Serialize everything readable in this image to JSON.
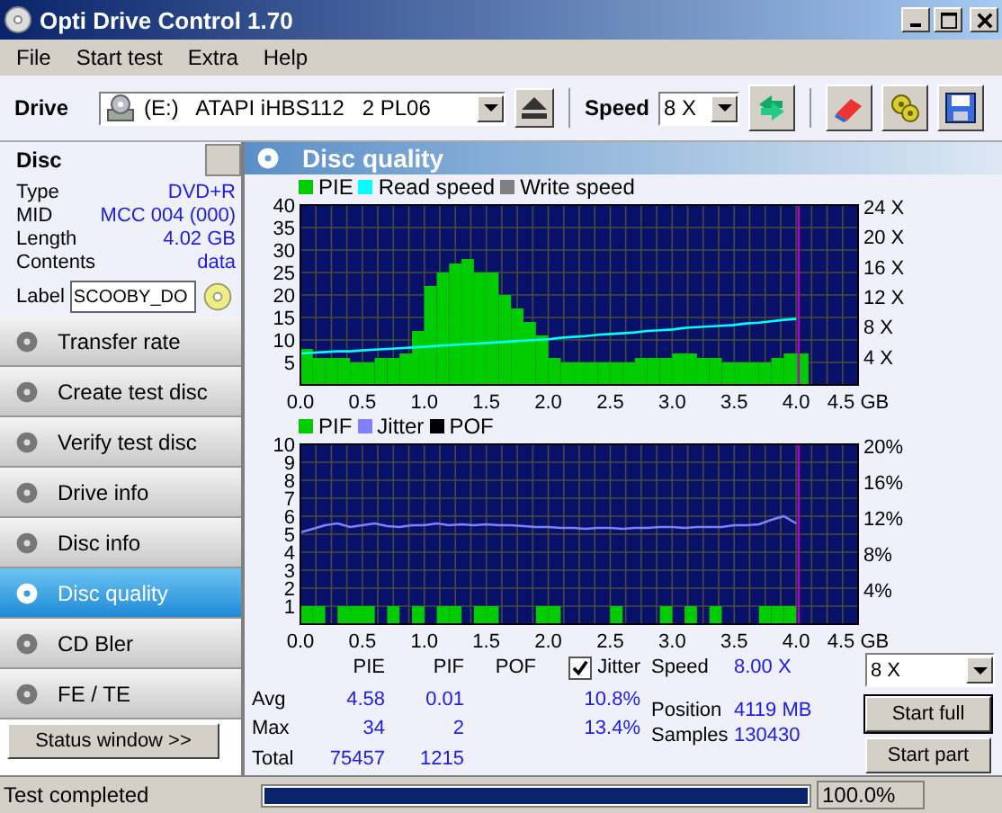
{
  "window": {
    "title": "Opti Drive Control 1.70"
  },
  "menu": [
    "File",
    "Start test",
    "Extra",
    "Help"
  ],
  "toolbar": {
    "drive_label": "Drive",
    "drive": "(E:)   ATAPI iHBS112   2 PL06",
    "speed_label": "Speed",
    "speed": "8 X"
  },
  "disc": {
    "title": "Disc",
    "fields": [
      {
        "label": "Type",
        "value": "DVD+R"
      },
      {
        "label": "MID",
        "value": "MCC 004 (000)"
      },
      {
        "label": "Length",
        "value": "4.02 GB"
      },
      {
        "label": "Contents",
        "value": "data"
      }
    ],
    "label_field": {
      "label": "Label",
      "value": "SCOOBY_DO"
    }
  },
  "nav": [
    {
      "label": "Transfer rate",
      "selected": false
    },
    {
      "label": "Create test disc",
      "selected": false
    },
    {
      "label": "Verify test disc",
      "selected": false
    },
    {
      "label": "Drive info",
      "selected": false
    },
    {
      "label": "Disc info",
      "selected": false
    },
    {
      "label": "Disc quality",
      "selected": true
    },
    {
      "label": "CD Bler",
      "selected": false
    },
    {
      "label": "FE / TE",
      "selected": false
    }
  ],
  "status_window_button": "Status window >>",
  "panel": {
    "title": "Disc quality",
    "charts": [
      {
        "chart_data": {
          "type": "bar",
          "x": [
            0,
            0.1,
            0.2,
            0.3,
            0.4,
            0.5,
            0.6,
            0.7,
            0.8,
            0.9,
            1,
            1.1,
            1.2,
            1.3,
            1.4,
            1.5,
            1.6,
            1.7,
            1.8,
            1.9,
            2,
            2.1,
            2.2,
            2.3,
            2.4,
            2.5,
            2.6,
            2.7,
            2.8,
            2.9,
            3,
            3.1,
            3.2,
            3.3,
            3.4,
            3.5,
            3.6,
            3.7,
            3.8,
            3.9,
            4
          ],
          "xlim": [
            0,
            4.5
          ],
          "ylim": [
            0,
            40
          ],
          "y2lim": [
            0,
            24
          ],
          "xticks": [
            {
              "value": 0,
              "label": "0.0"
            },
            {
              "value": 0.5,
              "label": "0.5"
            },
            {
              "value": 1,
              "label": "1.0"
            },
            {
              "value": 1.5,
              "label": "1.5"
            },
            {
              "value": 2,
              "label": "2.0"
            },
            {
              "value": 2.5,
              "label": "2.5"
            },
            {
              "value": 3,
              "label": "3.0"
            },
            {
              "value": 3.5,
              "label": "3.5"
            },
            {
              "value": 4,
              "label": "4.0"
            },
            {
              "value": 4.5,
              "label": "4.5 GB"
            }
          ],
          "yticks": [
            5,
            10,
            15,
            20,
            25,
            30,
            35,
            40
          ],
          "y2ticks": [
            {
              "value": 4,
              "label": "4 X"
            },
            {
              "value": 8,
              "label": "8 X"
            },
            {
              "value": 12,
              "label": "12 X"
            },
            {
              "value": 16,
              "label": "16 X"
            },
            {
              "value": 20,
              "label": "20 X"
            },
            {
              "value": 24,
              "label": "24 X"
            }
          ],
          "series": [
            {
              "name": "PIE",
              "type": "bar",
              "color": "#00cc00",
              "values": [
                8,
                6,
                6,
                6,
                5,
                5,
                6,
                6,
                7,
                12,
                22,
                25,
                27,
                28,
                25,
                25,
                20,
                17,
                14,
                11,
                6,
                5,
                5,
                5,
                5,
                5,
                5,
                6,
                6,
                6,
                7,
                7,
                6,
                6,
                5,
                5,
                5,
                5,
                6,
                7,
                7
              ]
            },
            {
              "name": "Read speed",
              "type": "line",
              "color": "#00ffff",
              "axis": "y2",
              "values": [
                4.2,
                4.3,
                4.4,
                4.5,
                4.5,
                4.6,
                4.7,
                4.8,
                4.9,
                5.0,
                5.1,
                5.2,
                5.3,
                5.4,
                5.5,
                5.6,
                5.7,
                5.8,
                5.9,
                6.0,
                6.1,
                6.3,
                6.4,
                6.5,
                6.7,
                6.8,
                6.9,
                7.0,
                7.2,
                7.3,
                7.4,
                7.6,
                7.7,
                7.8,
                7.9,
                8.0,
                8.2,
                8.3,
                8.5,
                8.7,
                8.8
              ]
            },
            {
              "name": "Write speed",
              "color": "#808080",
              "values": [
                null,
                null,
                null,
                null,
                null,
                null,
                null,
                null,
                null,
                null,
                null,
                null,
                null,
                null,
                null,
                null,
                null,
                null,
                null,
                null,
                null,
                null,
                null,
                null,
                null,
                null,
                null,
                null,
                null,
                null,
                null,
                null,
                null,
                null,
                null,
                null,
                null,
                null,
                null,
                null,
                null
              ]
            }
          ],
          "grid": true,
          "legend": true,
          "ref_lines": [
            {
              "axis": "x",
              "value": 4.02,
              "color": "#c000c0"
            }
          ]
        }
      },
      {
        "chart_data": {
          "type": "bar",
          "x": [
            0,
            0.1,
            0.2,
            0.3,
            0.4,
            0.5,
            0.6,
            0.7,
            0.8,
            0.9,
            1,
            1.1,
            1.2,
            1.3,
            1.4,
            1.5,
            1.6,
            1.7,
            1.8,
            1.9,
            2,
            2.1,
            2.2,
            2.3,
            2.4,
            2.5,
            2.6,
            2.7,
            2.8,
            2.9,
            3,
            3.1,
            3.2,
            3.3,
            3.4,
            3.5,
            3.6,
            3.7,
            3.8,
            3.9,
            4
          ],
          "xlim": [
            0,
            4.5
          ],
          "ylim": [
            0,
            10
          ],
          "y2lim": [
            0,
            20
          ],
          "xticks": [
            {
              "value": 0,
              "label": "0.0"
            },
            {
              "value": 0.5,
              "label": "0.5"
            },
            {
              "value": 1,
              "label": "1.0"
            },
            {
              "value": 1.5,
              "label": "1.5"
            },
            {
              "value": 2,
              "label": "2.0"
            },
            {
              "value": 2.5,
              "label": "2.5"
            },
            {
              "value": 3,
              "label": "3.0"
            },
            {
              "value": 3.5,
              "label": "3.5"
            },
            {
              "value": 4,
              "label": "4.0"
            },
            {
              "value": 4.5,
              "label": "4.5 GB"
            }
          ],
          "yticks": [
            1,
            2,
            3,
            4,
            5,
            6,
            7,
            8,
            9,
            10
          ],
          "y2ticks": [
            {
              "value": 4,
              "label": "4%"
            },
            {
              "value": 8,
              "label": "8%"
            },
            {
              "value": 12,
              "label": "12%"
            },
            {
              "value": 16,
              "label": "16%"
            },
            {
              "value": 20,
              "label": "20%"
            }
          ],
          "series": [
            {
              "name": "PIF",
              "type": "bar",
              "color": "#00cc00",
              "values": [
                1,
                1,
                0,
                1,
                1,
                1,
                0,
                1,
                0,
                1,
                0,
                1,
                1,
                0,
                1,
                1,
                0,
                0,
                0,
                1,
                1,
                0,
                0,
                0,
                0,
                1,
                0,
                0,
                0,
                1,
                0,
                1,
                0,
                1,
                0,
                0,
                0,
                1,
                1,
                1,
                0
              ]
            },
            {
              "name": "Jitter",
              "type": "line",
              "color": "#8080ff",
              "axis": "y2",
              "values": [
                10.2,
                10.6,
                11.0,
                11.2,
                10.8,
                11.0,
                11.2,
                10.9,
                10.8,
                11.0,
                11.0,
                11.2,
                11.0,
                11.1,
                11.0,
                11.1,
                11.0,
                11.0,
                10.9,
                10.8,
                10.8,
                10.7,
                10.7,
                10.6,
                10.7,
                10.7,
                10.6,
                10.7,
                10.7,
                10.8,
                10.8,
                10.7,
                10.8,
                10.8,
                10.8,
                11.0,
                11.0,
                11.1,
                11.6,
                12.0,
                11.2
              ]
            },
            {
              "name": "POF",
              "color": "#000000",
              "values": [
                0,
                0,
                0,
                0,
                0,
                0,
                0,
                0,
                0,
                0,
                0,
                0,
                0,
                0,
                0,
                0,
                0,
                0,
                0,
                0,
                0,
                0,
                0,
                0,
                0,
                0,
                0,
                0,
                0,
                0,
                0,
                0,
                0,
                0,
                0,
                0,
                0,
                0,
                0,
                0,
                0
              ]
            }
          ],
          "grid": true,
          "legend": true,
          "ref_lines": [
            {
              "axis": "x",
              "value": 4.02,
              "color": "#c000c0"
            }
          ]
        }
      }
    ],
    "stats": {
      "columns": [
        "PIE",
        "PIF",
        "POF"
      ],
      "jitter": {
        "label": "Jitter",
        "checked": true
      },
      "rows": [
        {
          "label": "Avg",
          "pie": "4.58",
          "pif": "0.01",
          "jitter": "10.8%"
        },
        {
          "label": "Max",
          "pie": "34",
          "pif": "2",
          "jitter": "13.4%"
        },
        {
          "label": "Total",
          "pie": "75457",
          "pif": "1215"
        }
      ],
      "info": [
        {
          "label": "Speed",
          "value": "8.00 X"
        },
        {
          "label": "Position",
          "value": "4119 MB"
        },
        {
          "label": "Samples",
          "value": "130430"
        }
      ],
      "speed_select": "8 X",
      "buttons": [
        "Start full",
        "Start part"
      ]
    }
  },
  "status_bar": {
    "text": "Test completed",
    "level": 1,
    "reading": "100.0%"
  }
}
